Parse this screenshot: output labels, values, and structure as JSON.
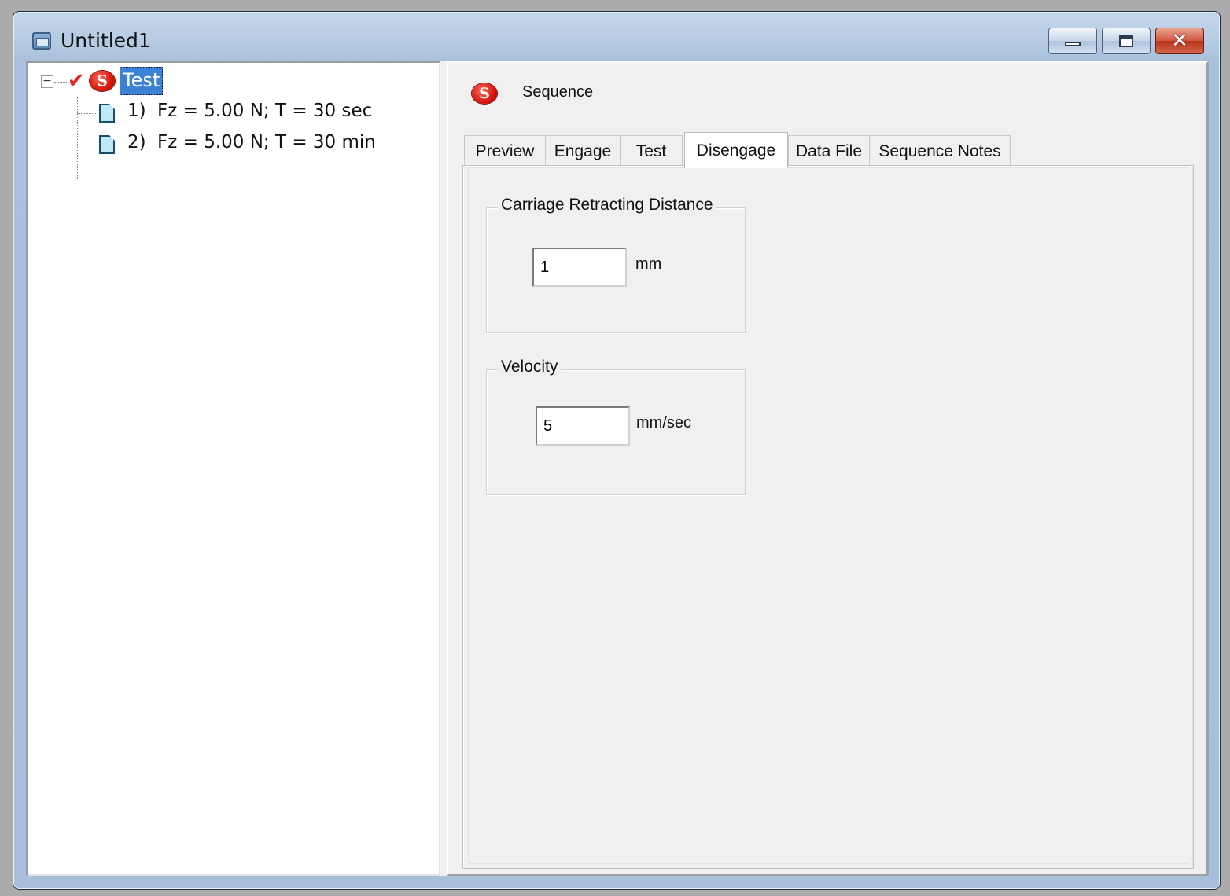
{
  "window": {
    "title": "Untitled1"
  },
  "window_controls": {
    "minimize": "minimize",
    "maximize": "maximize",
    "close": "✕"
  },
  "tree": {
    "root": {
      "label": "Test",
      "checked": true
    },
    "children": [
      {
        "number": "1)",
        "text": "Fz = 5.00 N; T = 30 sec"
      },
      {
        "number": "2)",
        "text": "Fz = 5.00 N; T = 30 min"
      }
    ]
  },
  "panel": {
    "header_label": "Sequence",
    "tabs": [
      {
        "label": "Preview"
      },
      {
        "label": "Engage"
      },
      {
        "label": "Test"
      },
      {
        "label": "Disengage"
      },
      {
        "label": "Data File"
      },
      {
        "label": "Sequence Notes"
      }
    ],
    "active_tab": "Disengage",
    "groups": {
      "carriage": {
        "title": "Carriage Retracting Distance",
        "value": "1",
        "unit": "mm"
      },
      "velocity": {
        "title": "Velocity",
        "value": "5",
        "unit": "mm/sec"
      }
    }
  },
  "icons": {
    "app": "window-icon",
    "sequence": "s-logo-icon",
    "step": "document-icon",
    "check": "checkmark-icon"
  },
  "colors": {
    "selection": "#3b82d6",
    "logo_red": "#d8150b",
    "check_red": "#e0241a",
    "close_button": "#c94a30"
  }
}
